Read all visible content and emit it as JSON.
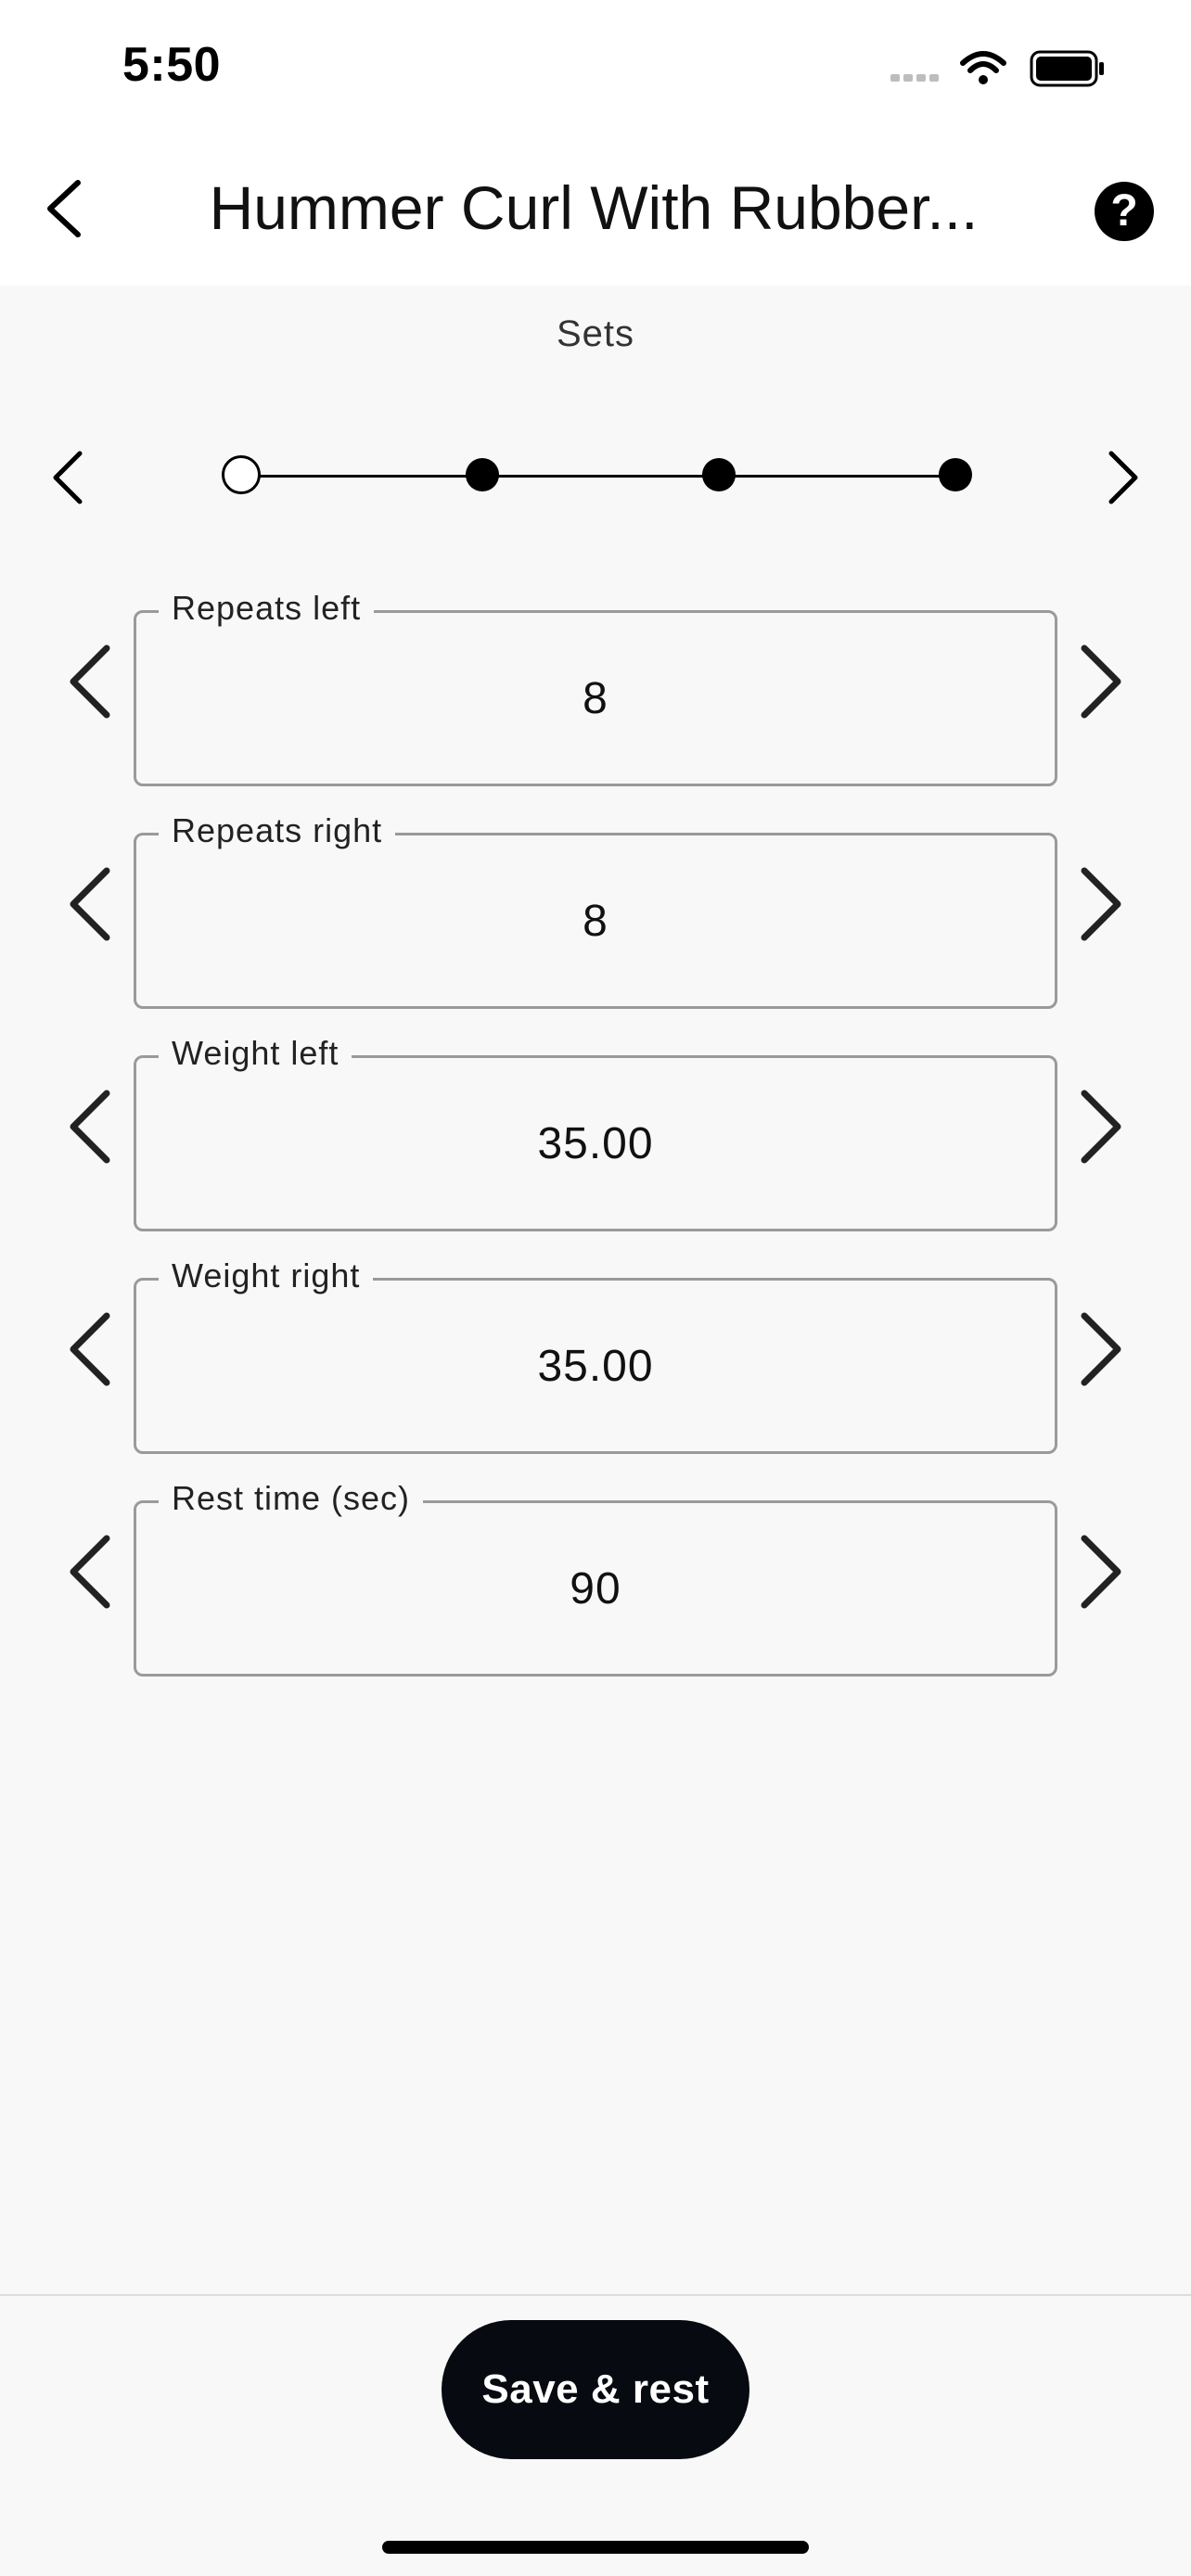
{
  "status_bar": {
    "time": "5:50"
  },
  "header": {
    "title": "Hummer Curl With Rubber...",
    "back_icon": "chevron-left-icon",
    "help_icon": "question-circle-icon"
  },
  "sets": {
    "label": "Sets",
    "total": 4,
    "active_index": 0
  },
  "fields": [
    {
      "label": "Repeats left",
      "value": "8"
    },
    {
      "label": "Repeats right",
      "value": "8"
    },
    {
      "label": "Weight left",
      "value": "35.00"
    },
    {
      "label": "Weight right",
      "value": "35.00"
    },
    {
      "label": "Rest time (sec)",
      "value": "90"
    }
  ],
  "footer": {
    "save_label": "Save & rest"
  },
  "colors": {
    "background": "#f8f8f8",
    "header_background": "#ffffff",
    "primary_button": "#070a10",
    "field_border": "#9a9a9a"
  }
}
